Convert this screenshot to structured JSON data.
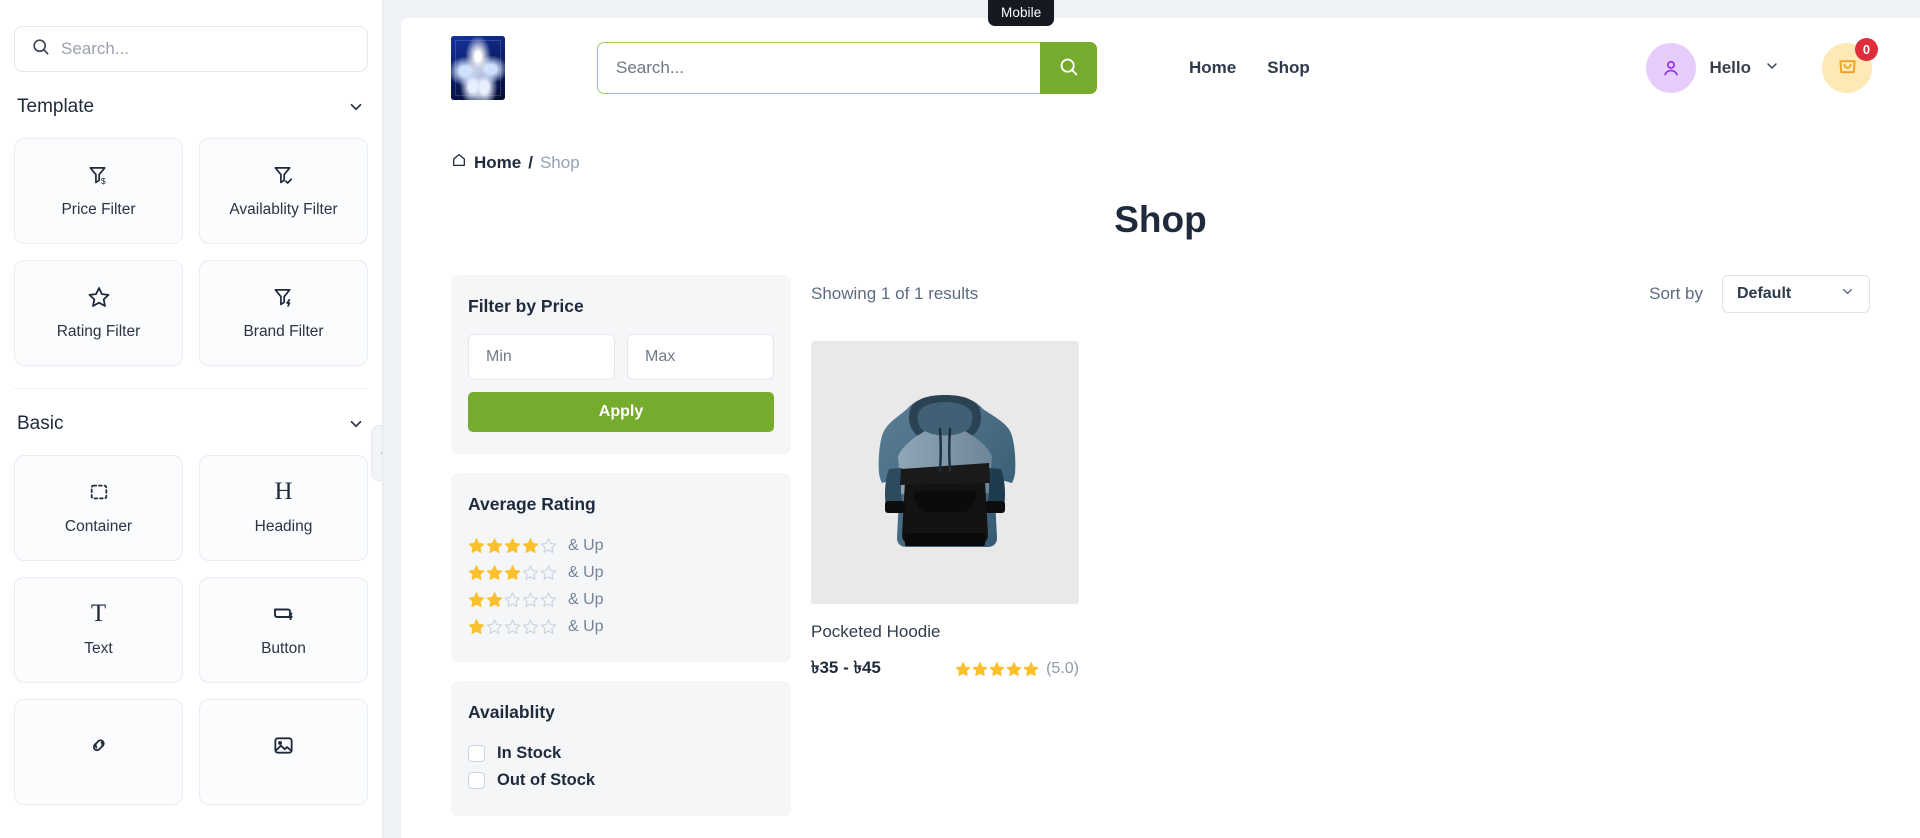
{
  "sidebar": {
    "search": {
      "placeholder": "Search...",
      "value": ""
    },
    "sections": [
      {
        "title": "Template",
        "items": [
          {
            "label": "Price Filter",
            "icon": "price-filter-icon"
          },
          {
            "label": "Availablity Filter",
            "icon": "availability-filter-icon"
          },
          {
            "label": "Rating Filter",
            "icon": "rating-filter-icon"
          },
          {
            "label": "Brand Filter",
            "icon": "brand-filter-icon"
          }
        ]
      },
      {
        "title": "Basic",
        "items": [
          {
            "label": "Container",
            "icon": "container-icon"
          },
          {
            "label": "Heading",
            "icon": "heading-icon"
          },
          {
            "label": "Text",
            "icon": "text-icon"
          },
          {
            "label": "Button",
            "icon": "button-icon"
          },
          {
            "label": "",
            "icon": "link-icon"
          },
          {
            "label": "",
            "icon": "image-icon"
          }
        ]
      }
    ]
  },
  "canvas": {
    "device_tab": "Mobile"
  },
  "store_header": {
    "search": {
      "placeholder": "Search...",
      "value": ""
    },
    "nav": [
      "Home",
      "Shop"
    ],
    "account_label": "Hello",
    "cart_count": "0"
  },
  "breadcrumb": {
    "home": "Home",
    "separator": "/",
    "current": "Shop"
  },
  "page": {
    "title": "Shop"
  },
  "filters": {
    "price": {
      "title": "Filter by Price",
      "min_placeholder": "Min",
      "max_placeholder": "Max",
      "min_value": "",
      "max_value": "",
      "apply_label": "Apply"
    },
    "rating": {
      "title": "Average Rating",
      "suffix": "& Up",
      "rows": [
        4,
        3,
        2,
        1
      ]
    },
    "availability": {
      "title": "Availablity",
      "options": [
        {
          "label": "In Stock",
          "checked": false
        },
        {
          "label": "Out of Stock",
          "checked": false
        }
      ]
    }
  },
  "results": {
    "showing": "Showing 1 of 1 results",
    "sort_label": "Sort by",
    "sort_value": "Default",
    "products": [
      {
        "name": "Pocketed Hoodie",
        "price": "৳35 - ৳45",
        "rating": 5,
        "rating_text": "(5.0)"
      }
    ]
  },
  "colors": {
    "accent_green": "#76ac2e",
    "star_yellow": "#fbc02d",
    "badge_red": "#e02d3c",
    "avatar_purple": "#e7cdfb",
    "cart_yellow": "#fde9b5",
    "text_dark": "#1f2a3c"
  }
}
